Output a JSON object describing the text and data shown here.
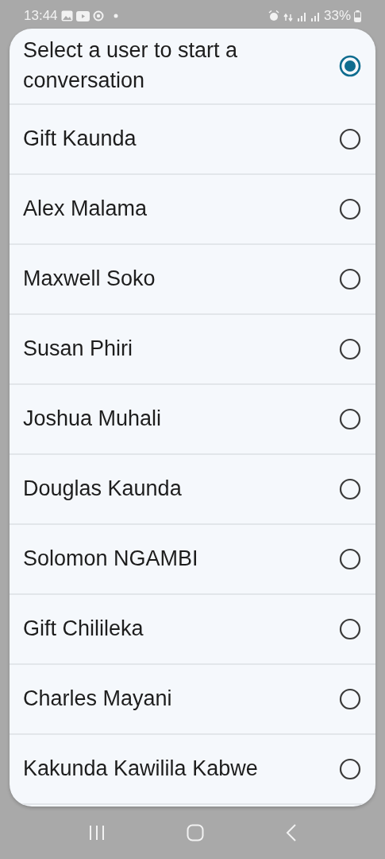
{
  "status_bar": {
    "time": "13:44",
    "battery": "33%"
  },
  "dialog": {
    "options": [
      {
        "label": "Select a user to start a conversation",
        "selected": true
      },
      {
        "label": "Gift Kaunda",
        "selected": false
      },
      {
        "label": "Alex Malama",
        "selected": false
      },
      {
        "label": "Maxwell Soko",
        "selected": false
      },
      {
        "label": "Susan Phiri",
        "selected": false
      },
      {
        "label": "Joshua Muhali",
        "selected": false
      },
      {
        "label": "Douglas Kaunda",
        "selected": false
      },
      {
        "label": "Solomon NGAMBI",
        "selected": false
      },
      {
        "label": "Gift Chilileka",
        "selected": false
      },
      {
        "label": "Charles Mayani",
        "selected": false
      },
      {
        "label": "Kakunda Kawilila Kabwe",
        "selected": false
      }
    ]
  }
}
